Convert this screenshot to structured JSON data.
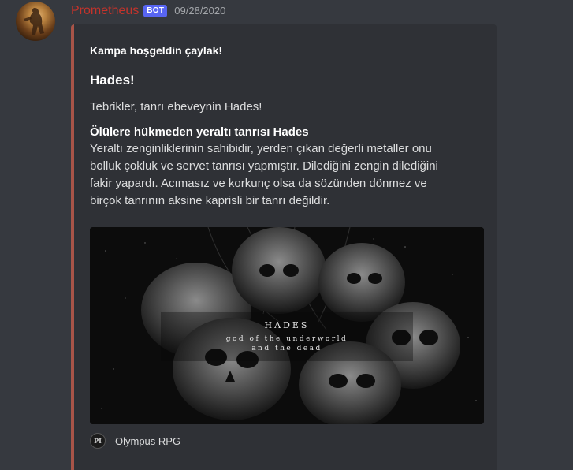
{
  "message": {
    "username": "Prometheus",
    "badge": "BOT",
    "timestamp": "09/28/2020",
    "avatar_icon": "user-avatar-icon",
    "colors": {
      "username": "#c4332b",
      "badge": "#5865f2",
      "embed_border": "#a85448"
    }
  },
  "embed": {
    "author": "Kampa hoşgeldin çaylak!",
    "title": "Hades!",
    "description": "Tebrikler, tanrı ebeveynin Hades!",
    "field": {
      "name": "Ölülere hükmeden yeraltı tanrısı Hades",
      "lines": [
        "Yeraltı zenginliklerinin sahibidir, yerden çıkan değerli metaller onu",
        "bolluk çokluk ve servet tanrısı yapmıştır. Dilediğini zengin dilediğini",
        "fakir yapardı. Acımasız ve korkunç olsa da sözünden dönmez ve",
        "birçok tanrının aksine kaprisli bir tanrı değildir."
      ]
    },
    "image": {
      "title": "HADES",
      "subtitle_line1": "god of the underworld",
      "subtitle_line2": "and the dead"
    },
    "footer": {
      "icon_text": "PI",
      "text": "Olympus RPG"
    }
  }
}
